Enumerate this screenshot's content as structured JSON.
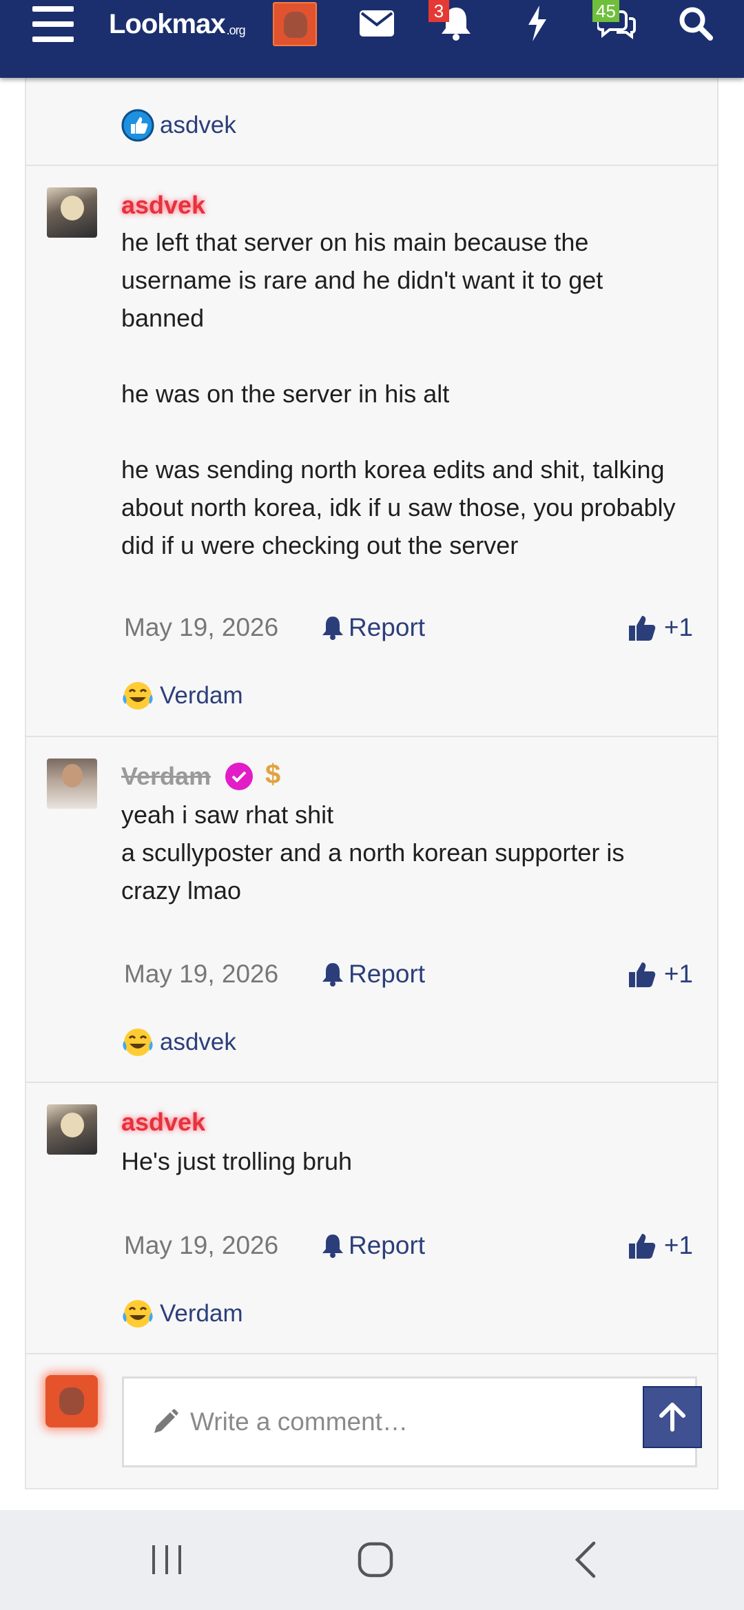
{
  "header": {
    "logo_text": "Lookmax",
    "logo_tld": ".org",
    "notifications_badge": "3",
    "conversations_badge": "45",
    "colors": {
      "bar": "#1b2f6e",
      "badge_red": "#e53935",
      "badge_green": "#6fbf3b"
    }
  },
  "top_reaction": {
    "user": "asdvek",
    "icon": "thumbs-up-reaction-icon"
  },
  "posts": [
    {
      "author": "asdvek",
      "paragraphs": [
        "he left that server on his main because the username is rare and he didn't want it to get banned",
        "he was on the server in his alt",
        "he was sending north korea edits and shit, talking about north korea, idk if u saw those, you probably did if u were checking out the server"
      ],
      "date": "May 19, 2026",
      "report_label": "Report",
      "like_count": "+1",
      "reaction_user": "Verdam",
      "reaction_icon": "laughing-tears-icon"
    },
    {
      "author": "Verdam",
      "paragraphs": [
        "yeah i saw rhat shit",
        "a scullyposter and a north korean supporter is crazy lmao"
      ],
      "date": "May 19, 2026",
      "report_label": "Report",
      "like_count": "+1",
      "reaction_user": "asdvek",
      "reaction_icon": "laughing-tears-icon"
    },
    {
      "author": "asdvek",
      "paragraphs": [
        "He's just trolling bruh"
      ],
      "date": "May 19, 2026",
      "report_label": "Report",
      "like_count": "+1",
      "reaction_user": "Verdam",
      "reaction_icon": "laughing-tears-icon"
    }
  ],
  "comment": {
    "placeholder": "Write a comment…"
  },
  "accent_colors": {
    "link": "#2c3e7a",
    "username_red": "#e6323c",
    "verified": "#e21cc6"
  }
}
